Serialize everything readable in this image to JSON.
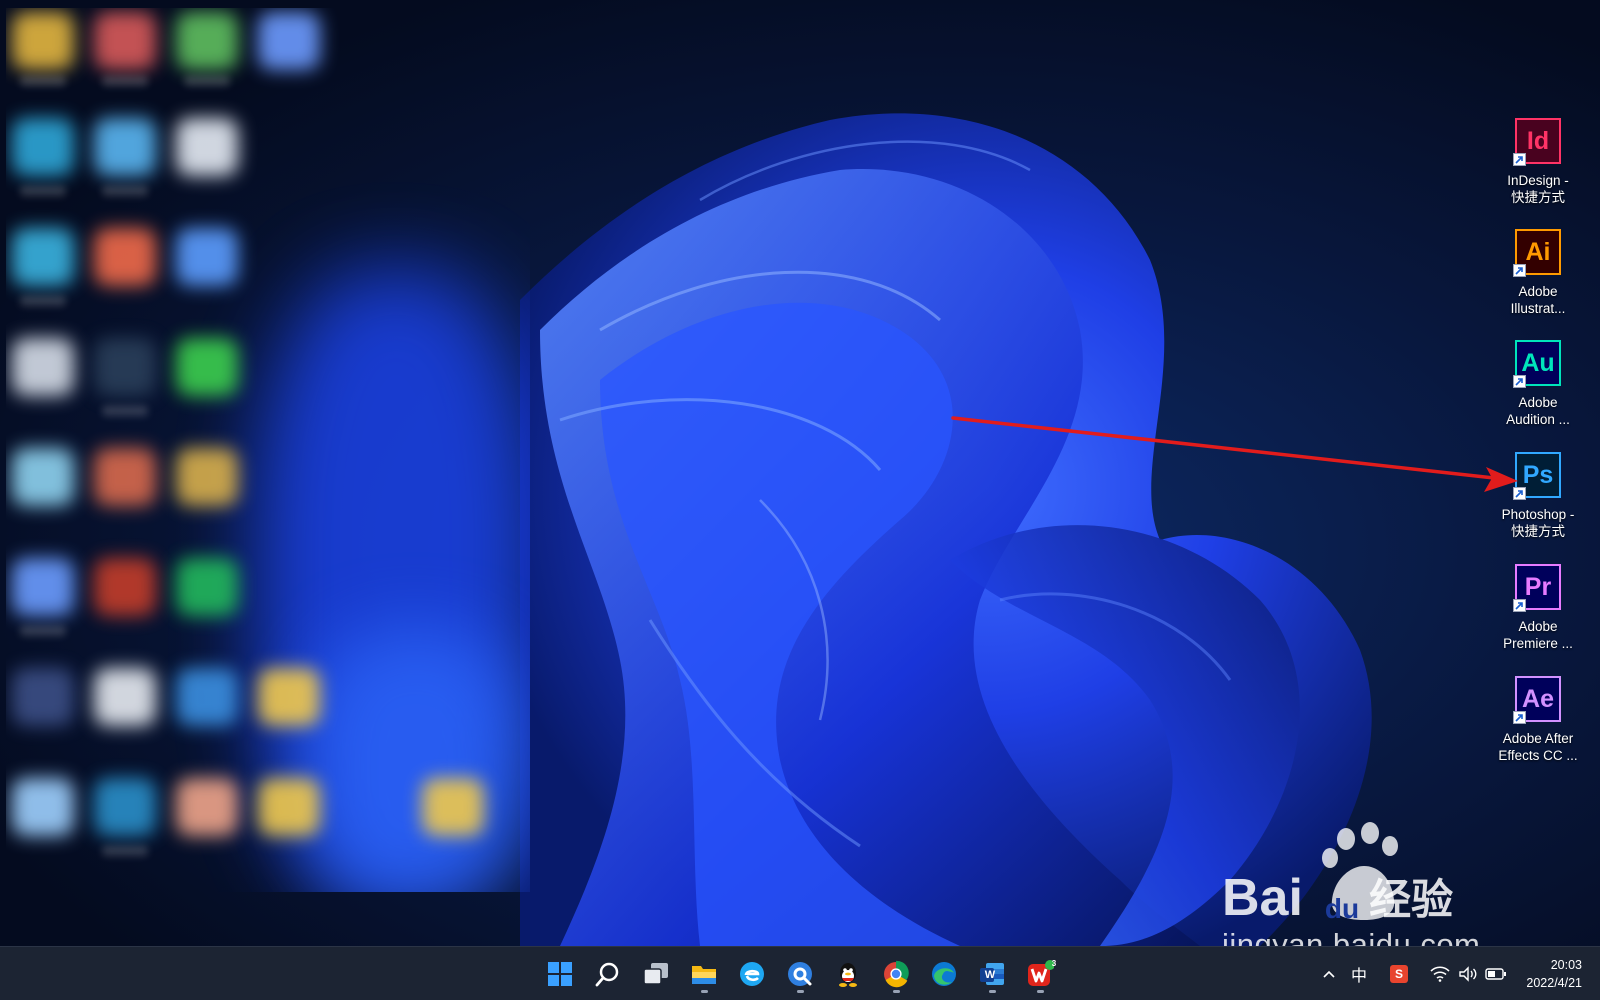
{
  "desktop": {
    "right_icons": [
      {
        "abbr": "Id",
        "label_line1": "InDesign -",
        "label_line2": "快捷方式",
        "color": "#ff3366",
        "bg": "#49021f"
      },
      {
        "abbr": "Ai",
        "label_line1": "Adobe",
        "label_line2": "Illustrat...",
        "color": "#ff9a00",
        "bg": "#330000"
      },
      {
        "abbr": "Au",
        "label_line1": "Adobe",
        "label_line2": "Audition ...",
        "color": "#00e4bb",
        "bg": "#00005b"
      },
      {
        "abbr": "Ps",
        "label_line1": "Photoshop -",
        "label_line2": "快捷方式",
        "color": "#31a8ff",
        "bg": "#001e36"
      },
      {
        "abbr": "Pr",
        "label_line1": "Adobe",
        "label_line2": "Premiere ...",
        "color": "#e77bff",
        "bg": "#00005b"
      },
      {
        "abbr": "Ae",
        "label_line1": "Adobe After",
        "label_line2": "Effects CC ...",
        "color": "#d291ff",
        "bg": "#00005b"
      }
    ],
    "annotation": {
      "color": "#e21c1c",
      "target": "Photoshop -"
    }
  },
  "watermark": {
    "brand_left": "Bai",
    "brand_paw": "du",
    "brand_cn": "经验",
    "url": "jingyan.baidu.com"
  },
  "taskbar": {
    "apps": [
      {
        "name": "start-icon"
      },
      {
        "name": "search-icon"
      },
      {
        "name": "task-view-icon"
      },
      {
        "name": "file-explorer-icon"
      },
      {
        "name": "ie-browser-icon"
      },
      {
        "name": "browser-search-icon"
      },
      {
        "name": "qq-icon"
      },
      {
        "name": "chrome-icon"
      },
      {
        "name": "edge-icon"
      },
      {
        "name": "word-icon"
      },
      {
        "name": "wps-icon"
      }
    ],
    "word_letter": "W",
    "wps_badge": "3",
    "tray": {
      "overflow_glyph": "^",
      "ime": "中",
      "sogou": "S",
      "time": "20:03",
      "date": "2022/4/21"
    }
  }
}
